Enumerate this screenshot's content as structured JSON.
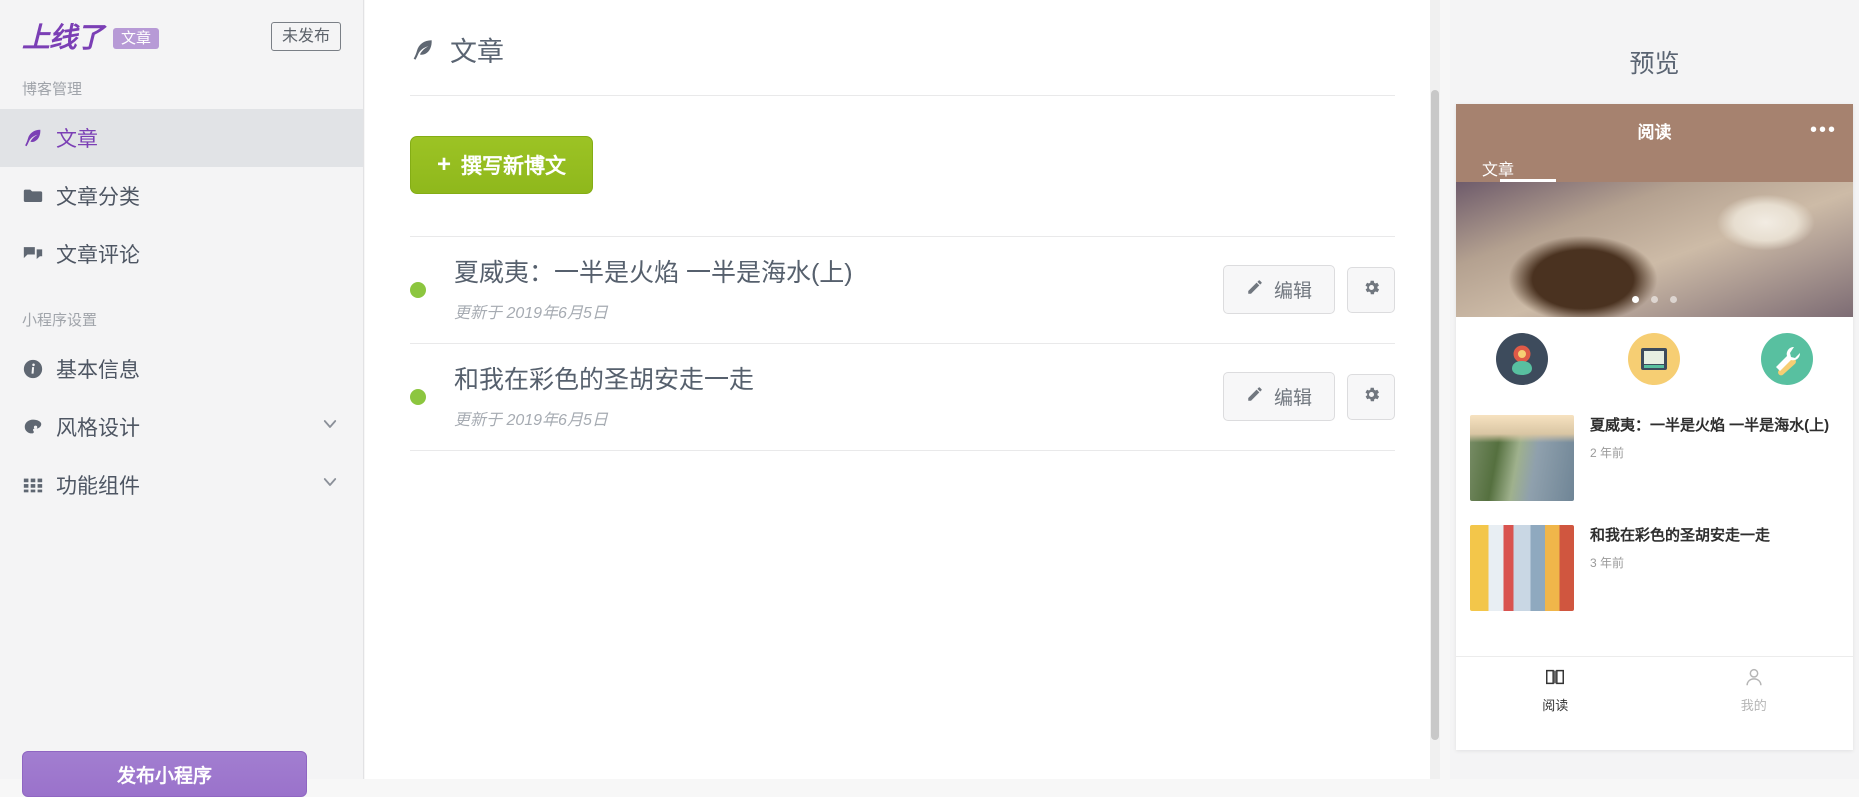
{
  "sidebar": {
    "brand": "上线了",
    "brand_tag": "文章",
    "publish_state": "未发布",
    "sections": [
      {
        "title": "博客管理",
        "items": [
          {
            "label": "文章",
            "icon": "feather-icon",
            "active": true,
            "chevron": false
          },
          {
            "label": "文章分类",
            "icon": "folder-icon",
            "active": false,
            "chevron": false
          },
          {
            "label": "文章评论",
            "icon": "comment-icon",
            "active": false,
            "chevron": false
          }
        ]
      },
      {
        "title": "小程序设置",
        "items": [
          {
            "label": "基本信息",
            "icon": "info-icon",
            "active": false,
            "chevron": false
          },
          {
            "label": "风格设计",
            "icon": "palette-icon",
            "active": false,
            "chevron": true
          },
          {
            "label": "功能组件",
            "icon": "grid-icon",
            "active": false,
            "chevron": true
          }
        ]
      }
    ],
    "cta_label": "发布小程序"
  },
  "main": {
    "title": "文章",
    "title_icon": "feather-icon",
    "new_post_label": "撰写新博文",
    "new_post_plus": "+",
    "posts": [
      {
        "title": "夏威夷：一半是火焰 一半是海水(上)",
        "meta": "更新于 2019年6月5日",
        "edit_label": "编辑",
        "status_color": "#8cc63f"
      },
      {
        "title": "和我在彩色的圣胡安走一走",
        "meta": "更新于 2019年6月5日",
        "edit_label": "编辑",
        "status_color": "#8cc63f"
      }
    ]
  },
  "preview": {
    "title": "预览",
    "phone": {
      "bar_title": "阅读",
      "bar_menu": "•••",
      "tab_label": "文章",
      "icons": [
        {
          "name": "flower-icon",
          "color": "#3d4b5c"
        },
        {
          "name": "tv-icon",
          "color": "#f6ce73"
        },
        {
          "name": "tools-icon",
          "color": "#58c0a0"
        }
      ],
      "articles": [
        {
          "title": "夏威夷：一半是火焰 一半是海水(上)",
          "time": "2 年前"
        },
        {
          "title": "和我在彩色的圣胡安走一走",
          "time": "3 年前"
        }
      ],
      "tabbar": [
        {
          "label": "阅读",
          "icon": "book-icon",
          "active": true
        },
        {
          "label": "我的",
          "icon": "person-icon",
          "active": false
        }
      ]
    }
  },
  "colors": {
    "brand_purple": "#7b3fb5",
    "accent_green": "#9cc324",
    "status_green": "#8cc63f",
    "phone_brown": "#a6826f"
  }
}
